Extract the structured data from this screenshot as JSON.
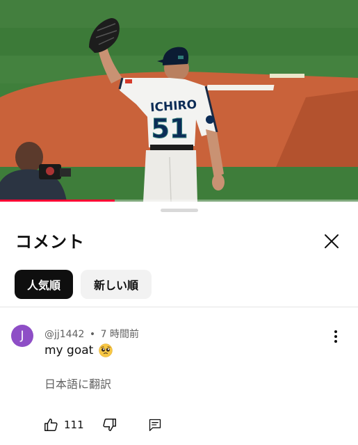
{
  "video": {
    "jersey_name": "ICHIRO",
    "jersey_number": "51",
    "progress_fraction": 0.32
  },
  "comments_panel": {
    "title": "コメント",
    "sort_chips": [
      {
        "label": "人気順",
        "active": true
      },
      {
        "label": "新しい順",
        "active": false
      }
    ],
    "comment": {
      "avatar_letter": "J",
      "avatar_color": "#8e4ec6",
      "author": "@jj1442",
      "time": "7 時間前",
      "separator": "•",
      "text": "my goat",
      "emoji": "pleading-face",
      "translate_label": "日本語に翻訳",
      "like_count": "111"
    }
  },
  "colors": {
    "progress": "#ff0033",
    "grass": "#3e7d3a",
    "dirt": "#c9623a",
    "chip_active_bg": "#0f0f0f",
    "chip_inactive_bg": "#f2f2f2"
  },
  "icons": [
    "close-icon",
    "more-vert-icon",
    "thumb-up-icon",
    "thumb-down-icon",
    "reply-icon"
  ]
}
